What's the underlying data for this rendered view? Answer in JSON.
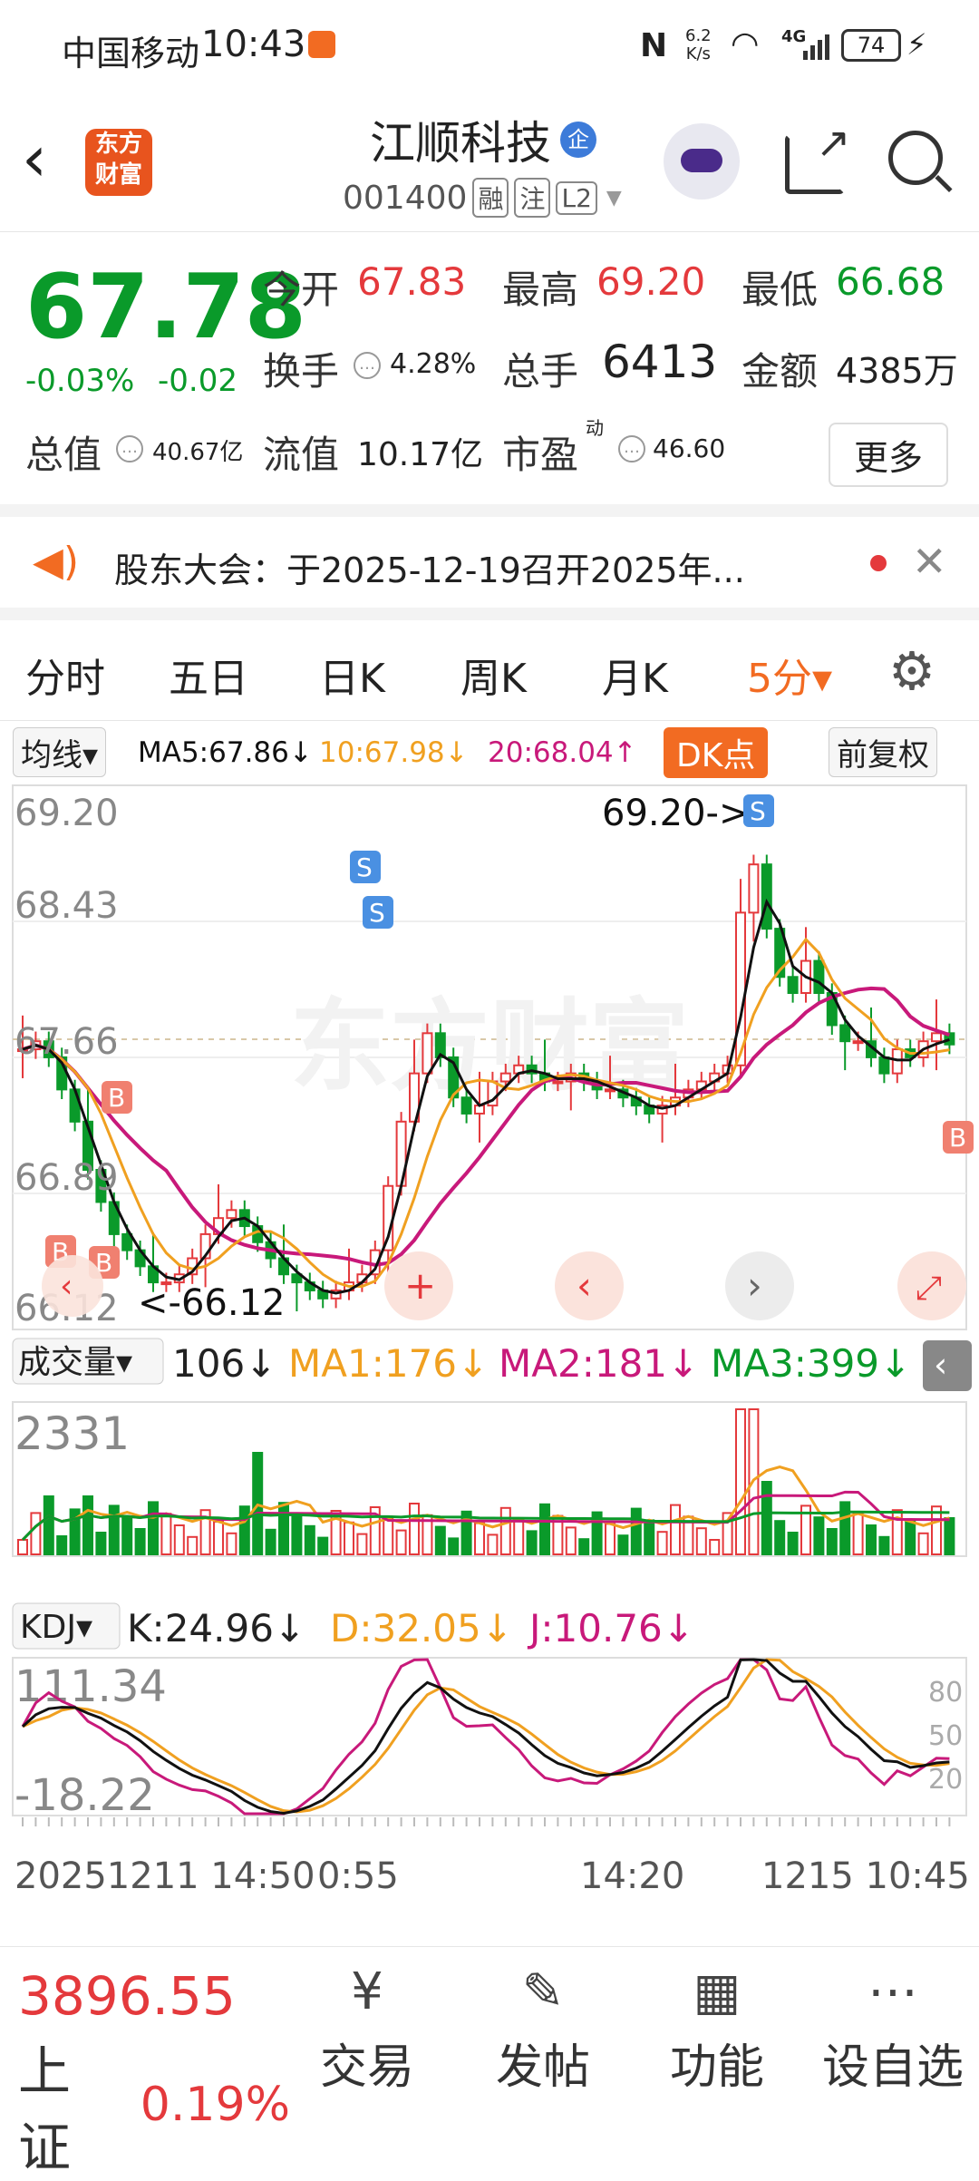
{
  "status_bar": {
    "carrier": "中国移动",
    "time": "10:43",
    "net_speed_top": "6.2",
    "net_speed_bottom": "K/s",
    "network": "4G",
    "battery": "74"
  },
  "header": {
    "logo_line1": "东方",
    "logo_line2": "财富",
    "stock_name": "江顺科技",
    "badge": "企",
    "stock_code": "001400",
    "tags": [
      "融",
      "注",
      "L2"
    ]
  },
  "quote": {
    "price": "67.78",
    "change_pct": "-0.03%",
    "change": "-0.02",
    "open_label": "今开",
    "open": "67.83",
    "high_label": "最高",
    "high": "69.20",
    "low_label": "最低",
    "low": "66.68",
    "turnover_label": "换手",
    "turnover": "4.28%",
    "volume_label": "总手",
    "volume": "6413",
    "amount_label": "金额",
    "amount": "4385万",
    "mktcap_label": "总值",
    "mktcap": "40.67亿",
    "float_label": "流值",
    "float_cap": "10.17亿",
    "pe_label": "市盈",
    "pe_sup": "动",
    "pe": "46.60",
    "more_label": "更多"
  },
  "notice": {
    "text": "股东大会：于2025-12-19召开2025年..."
  },
  "tabs": [
    "分时",
    "五日",
    "日K",
    "周K",
    "月K",
    "5分▾"
  ],
  "active_tab": "5分▾",
  "ma_row": {
    "selector": "均线▾",
    "ma5": "MA5:67.86↓",
    "ma10": "10:67.98↓",
    "ma20": "20:68.04↑",
    "dk_button": "DK点",
    "adjust_button": "前复权"
  },
  "price_chart": {
    "y_labels": [
      "69.20",
      "68.43",
      "67.66",
      "66.89",
      "66.12"
    ],
    "max_annotation": "69.20->",
    "min_annotation": "<-66.12",
    "colors": {
      "up": "#e4393c",
      "down": "#0a9a2a",
      "ma5": "#111111",
      "ma10": "#f0a020",
      "ma20": "#c8197a"
    }
  },
  "volume_row": {
    "selector": "成交量▾",
    "current": "106↓",
    "ma1": "MA1:176↓",
    "ma2": "MA2:181↓",
    "ma3": "MA3:399↓",
    "y_label": "2331"
  },
  "kdj_row": {
    "selector": "KDJ▾",
    "k": "K:24.96↓",
    "d": "D:32.05↓",
    "j": "J:10.76↓",
    "y_top": "111.34",
    "y_bottom": "-18.22",
    "levels": [
      "80",
      "50",
      "20"
    ]
  },
  "x_axis": [
    "20251211 14:50",
    "0:55",
    "14:20",
    "1215 10:45"
  ],
  "bottom_bar": {
    "index_value": "3896.55",
    "index_name": "上证",
    "index_change": "0.19%",
    "nav": [
      {
        "label": "交易",
        "icon": "trade-icon"
      },
      {
        "label": "发帖",
        "icon": "post-icon"
      },
      {
        "label": "功能",
        "icon": "apps-icon"
      },
      {
        "label": "设自选",
        "icon": "more-icon"
      }
    ]
  }
}
